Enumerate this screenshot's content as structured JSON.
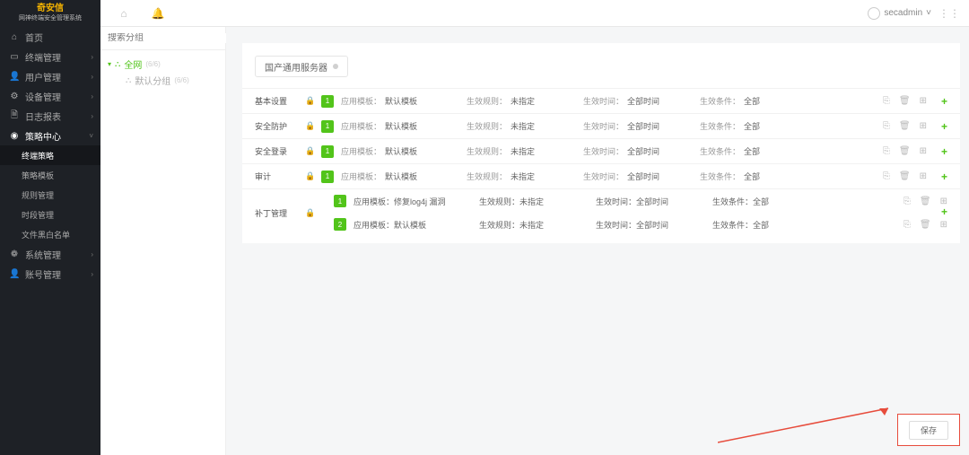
{
  "brand": {
    "name": "奇安信",
    "tagline": "网神终端安全管理系统"
  },
  "header": {
    "user": "secadmin",
    "icons": {
      "home": "home-icon",
      "bell": "bell-icon",
      "user": "user-icon",
      "grid": "grid-icon"
    }
  },
  "nav": {
    "items": [
      {
        "icon": "⌂",
        "label": "首页"
      },
      {
        "icon": "▭",
        "label": "终端管理",
        "chev": "›"
      },
      {
        "icon": "👤",
        "label": "用户管理",
        "chev": "›"
      },
      {
        "icon": "⚙",
        "label": "设备管理",
        "chev": "›"
      },
      {
        "icon": "🗎",
        "label": "日志报表",
        "chev": "›"
      },
      {
        "icon": "◉",
        "label": "策略中心",
        "chev": "˅",
        "open": true,
        "children": [
          {
            "label": "终端策略",
            "active": true
          },
          {
            "label": "策略模板"
          },
          {
            "label": "规则管理"
          },
          {
            "label": "时段管理"
          },
          {
            "label": "文件黑白名单"
          }
        ]
      },
      {
        "icon": "❁",
        "label": "系统管理",
        "chev": "›"
      },
      {
        "icon": "👤",
        "label": "账号管理",
        "chev": "›"
      }
    ]
  },
  "tree": {
    "search_placeholder": "搜索分组",
    "root": {
      "label": "全网",
      "count": "(6/6)"
    },
    "child": {
      "label": "默认分组",
      "count": "(6/6)"
    }
  },
  "main": {
    "pill_label": "国产通用服务器",
    "columns": {
      "tpl": "应用模板：",
      "rule": "生效规则：",
      "time": "生效时间：",
      "cond": "生效条件："
    },
    "values": {
      "default_tpl": "默认模板",
      "unspecified": "未指定",
      "all_time": "全部时间",
      "all": "全部"
    },
    "rows": [
      {
        "cat": "基本设置",
        "num": "1",
        "tpl": "默认模板",
        "rule": "未指定",
        "time": "全部时间",
        "cond": "全部"
      },
      {
        "cat": "安全防护",
        "num": "1",
        "tpl": "默认模板",
        "rule": "未指定",
        "time": "全部时间",
        "cond": "全部"
      },
      {
        "cat": "安全登录",
        "num": "1",
        "tpl": "默认模板",
        "rule": "未指定",
        "time": "全部时间",
        "cond": "全部"
      },
      {
        "cat": "审计",
        "num": "1",
        "tpl": "默认模板",
        "rule": "未指定",
        "time": "全部时间",
        "cond": "全部"
      }
    ],
    "group": {
      "cat": "补丁管理",
      "subrows": [
        {
          "num": "1",
          "tpl": "修复log4j 漏洞",
          "rule": "未指定",
          "time": "全部时间",
          "cond": "全部"
        },
        {
          "num": "2",
          "tpl": "默认模板",
          "rule": "未指定",
          "time": "全部时间",
          "cond": "全部"
        }
      ]
    },
    "save_label": "保存"
  }
}
